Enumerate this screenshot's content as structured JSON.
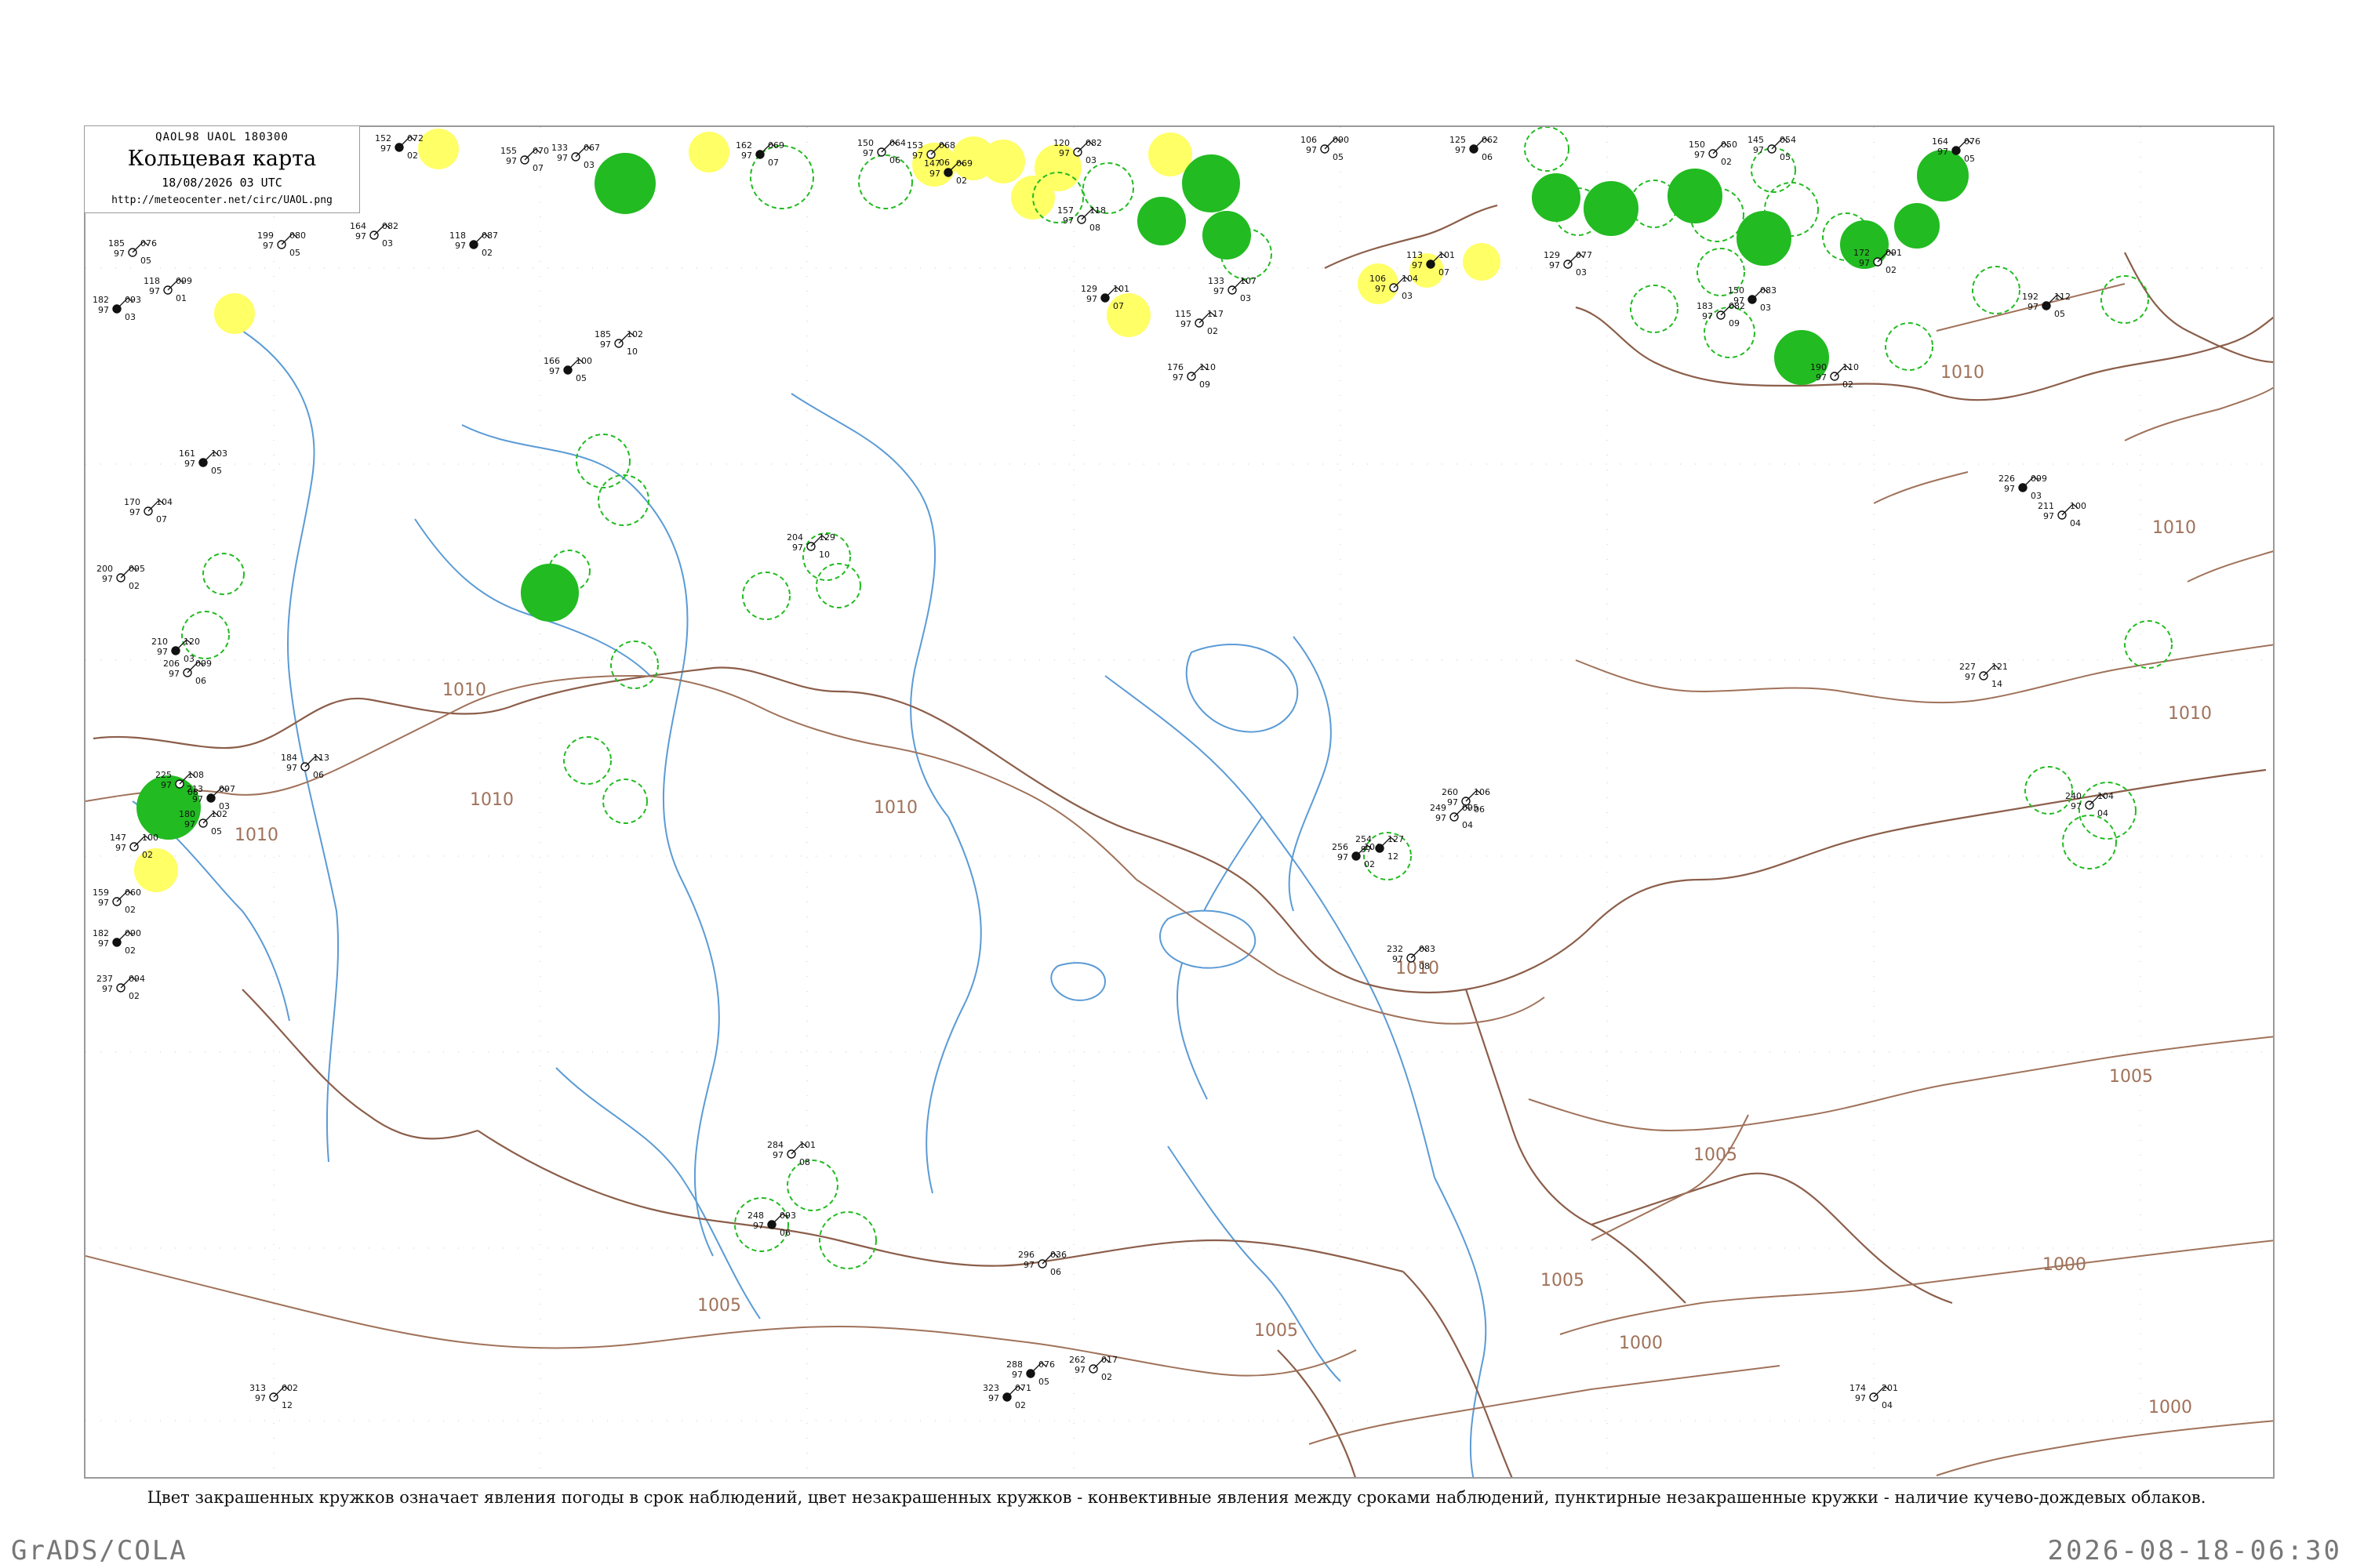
{
  "header": {
    "codes": "QAOL98  UAOL  180300",
    "title": "Кольцевая карта",
    "time": "18/08/2026 03 UTC",
    "url": "http://meteocenter.net/circ/UAOL.png"
  },
  "caption": "Цвет закрашенных кружков означает явления погоды в срок наблюдений, цвет незакрашенных кружков - конвективные явления между сроками наблюдений, пунктирные незакрашенные кружки - наличие кучево-дождевых облаков.",
  "footer": {
    "left": "GrADS/COLA",
    "right": "2026-08-18-06:30"
  },
  "colors": {
    "rivers": "#5b9bd5",
    "borders": "#8b5e4a",
    "isobars": "#a0725a",
    "fog_fill": "#ffff66",
    "rain_fill": "#22bb22",
    "cb_dash": "#22bb22"
  },
  "isobar_labels": [
    "1010",
    "1010",
    "1010",
    "1010",
    "1010",
    "1010",
    "1010",
    "1010",
    "1005",
    "1005",
    "1005",
    "1005",
    "1005",
    "1000",
    "1000",
    "1000"
  ],
  "stations": [
    {
      "p": "152",
      "t": "072",
      "d": "02"
    },
    {
      "p": "133",
      "t": "067",
      "d": "03"
    },
    {
      "p": "155",
      "t": "070",
      "d": "07"
    },
    {
      "p": "162",
      "t": "069",
      "d": "07"
    },
    {
      "p": "150",
      "t": "064",
      "d": "06"
    },
    {
      "p": "153",
      "t": "068",
      "d": "06"
    },
    {
      "p": "147",
      "t": "069",
      "d": "02"
    },
    {
      "p": "120",
      "t": "082",
      "d": "03"
    },
    {
      "p": "106",
      "t": "090",
      "d": "05"
    },
    {
      "p": "125",
      "t": "062",
      "d": "06"
    },
    {
      "p": "150",
      "t": "050",
      "d": "02"
    },
    {
      "p": "145",
      "t": "054",
      "d": "05"
    },
    {
      "p": "164",
      "t": "076",
      "d": "05"
    },
    {
      "p": "185",
      "t": "076",
      "d": "05"
    },
    {
      "p": "118",
      "t": "099",
      "d": "01"
    },
    {
      "p": "182",
      "t": "093",
      "d": "03"
    },
    {
      "p": "164",
      "t": "082",
      "d": "03"
    },
    {
      "p": "199",
      "t": "080",
      "d": "05"
    },
    {
      "p": "118",
      "t": "087",
      "d": "02"
    },
    {
      "p": "157",
      "t": "118",
      "d": "08"
    },
    {
      "p": "185",
      "t": "102",
      "d": "10"
    },
    {
      "p": "166",
      "t": "100",
      "d": "05"
    },
    {
      "p": "176",
      "t": "110",
      "d": "09"
    },
    {
      "p": "115",
      "t": "117",
      "d": "02"
    },
    {
      "p": "129",
      "t": "101",
      "d": "07"
    },
    {
      "p": "133",
      "t": "107",
      "d": "03"
    },
    {
      "p": "106",
      "t": "104",
      "d": "03"
    },
    {
      "p": "113",
      "t": "101",
      "d": "07"
    },
    {
      "p": "129",
      "t": "077",
      "d": "03"
    },
    {
      "p": "183",
      "t": "082",
      "d": "09"
    },
    {
      "p": "150",
      "t": "083",
      "d": "03"
    },
    {
      "p": "190",
      "t": "110",
      "d": "02"
    },
    {
      "p": "172",
      "t": "091",
      "d": "02"
    },
    {
      "p": "192",
      "t": "112",
      "d": "05"
    },
    {
      "p": "225",
      "t": "108",
      "d": "08"
    },
    {
      "p": "147",
      "t": "100",
      "d": "02"
    },
    {
      "p": "210",
      "t": "120",
      "d": "03"
    },
    {
      "p": "200",
      "t": "095",
      "d": "02"
    },
    {
      "p": "170",
      "t": "104",
      "d": "07"
    },
    {
      "p": "161",
      "t": "103",
      "d": "05"
    },
    {
      "p": "206",
      "t": "099",
      "d": "06"
    },
    {
      "p": "184",
      "t": "113",
      "d": "06"
    },
    {
      "p": "213",
      "t": "097",
      "d": "03"
    },
    {
      "p": "180",
      "t": "102",
      "d": "05"
    },
    {
      "p": "159",
      "t": "060",
      "d": "02"
    },
    {
      "p": "182",
      "t": "090",
      "d": "02"
    },
    {
      "p": "237",
      "t": "094",
      "d": "02"
    },
    {
      "p": "204",
      "t": "129",
      "d": "10"
    },
    {
      "p": "254",
      "t": "127",
      "d": "12"
    },
    {
      "p": "227",
      "t": "121",
      "d": "14"
    },
    {
      "p": "240",
      "t": "104",
      "d": "04"
    },
    {
      "p": "226",
      "t": "099",
      "d": "03"
    },
    {
      "p": "211",
      "t": "100",
      "d": "04"
    },
    {
      "p": "284",
      "t": "101",
      "d": "08"
    },
    {
      "p": "248",
      "t": "093",
      "d": "06"
    },
    {
      "p": "260",
      "t": "106",
      "d": "06"
    },
    {
      "p": "249",
      "t": "095",
      "d": "04"
    },
    {
      "p": "256",
      "t": "104",
      "d": "02"
    },
    {
      "p": "174",
      "t": "201",
      "d": "04"
    },
    {
      "p": "313",
      "t": "002",
      "d": "12"
    },
    {
      "p": "323",
      "t": "071",
      "d": "02"
    },
    {
      "p": "262",
      "t": "017",
      "d": "02"
    },
    {
      "p": "296",
      "t": "036",
      "d": "06"
    },
    {
      "p": "288",
      "t": "076",
      "d": "05"
    },
    {
      "p": "232",
      "t": "083",
      "d": "08"
    },
    {
      "p": "260",
      "t": "102",
      "d": "04"
    }
  ]
}
